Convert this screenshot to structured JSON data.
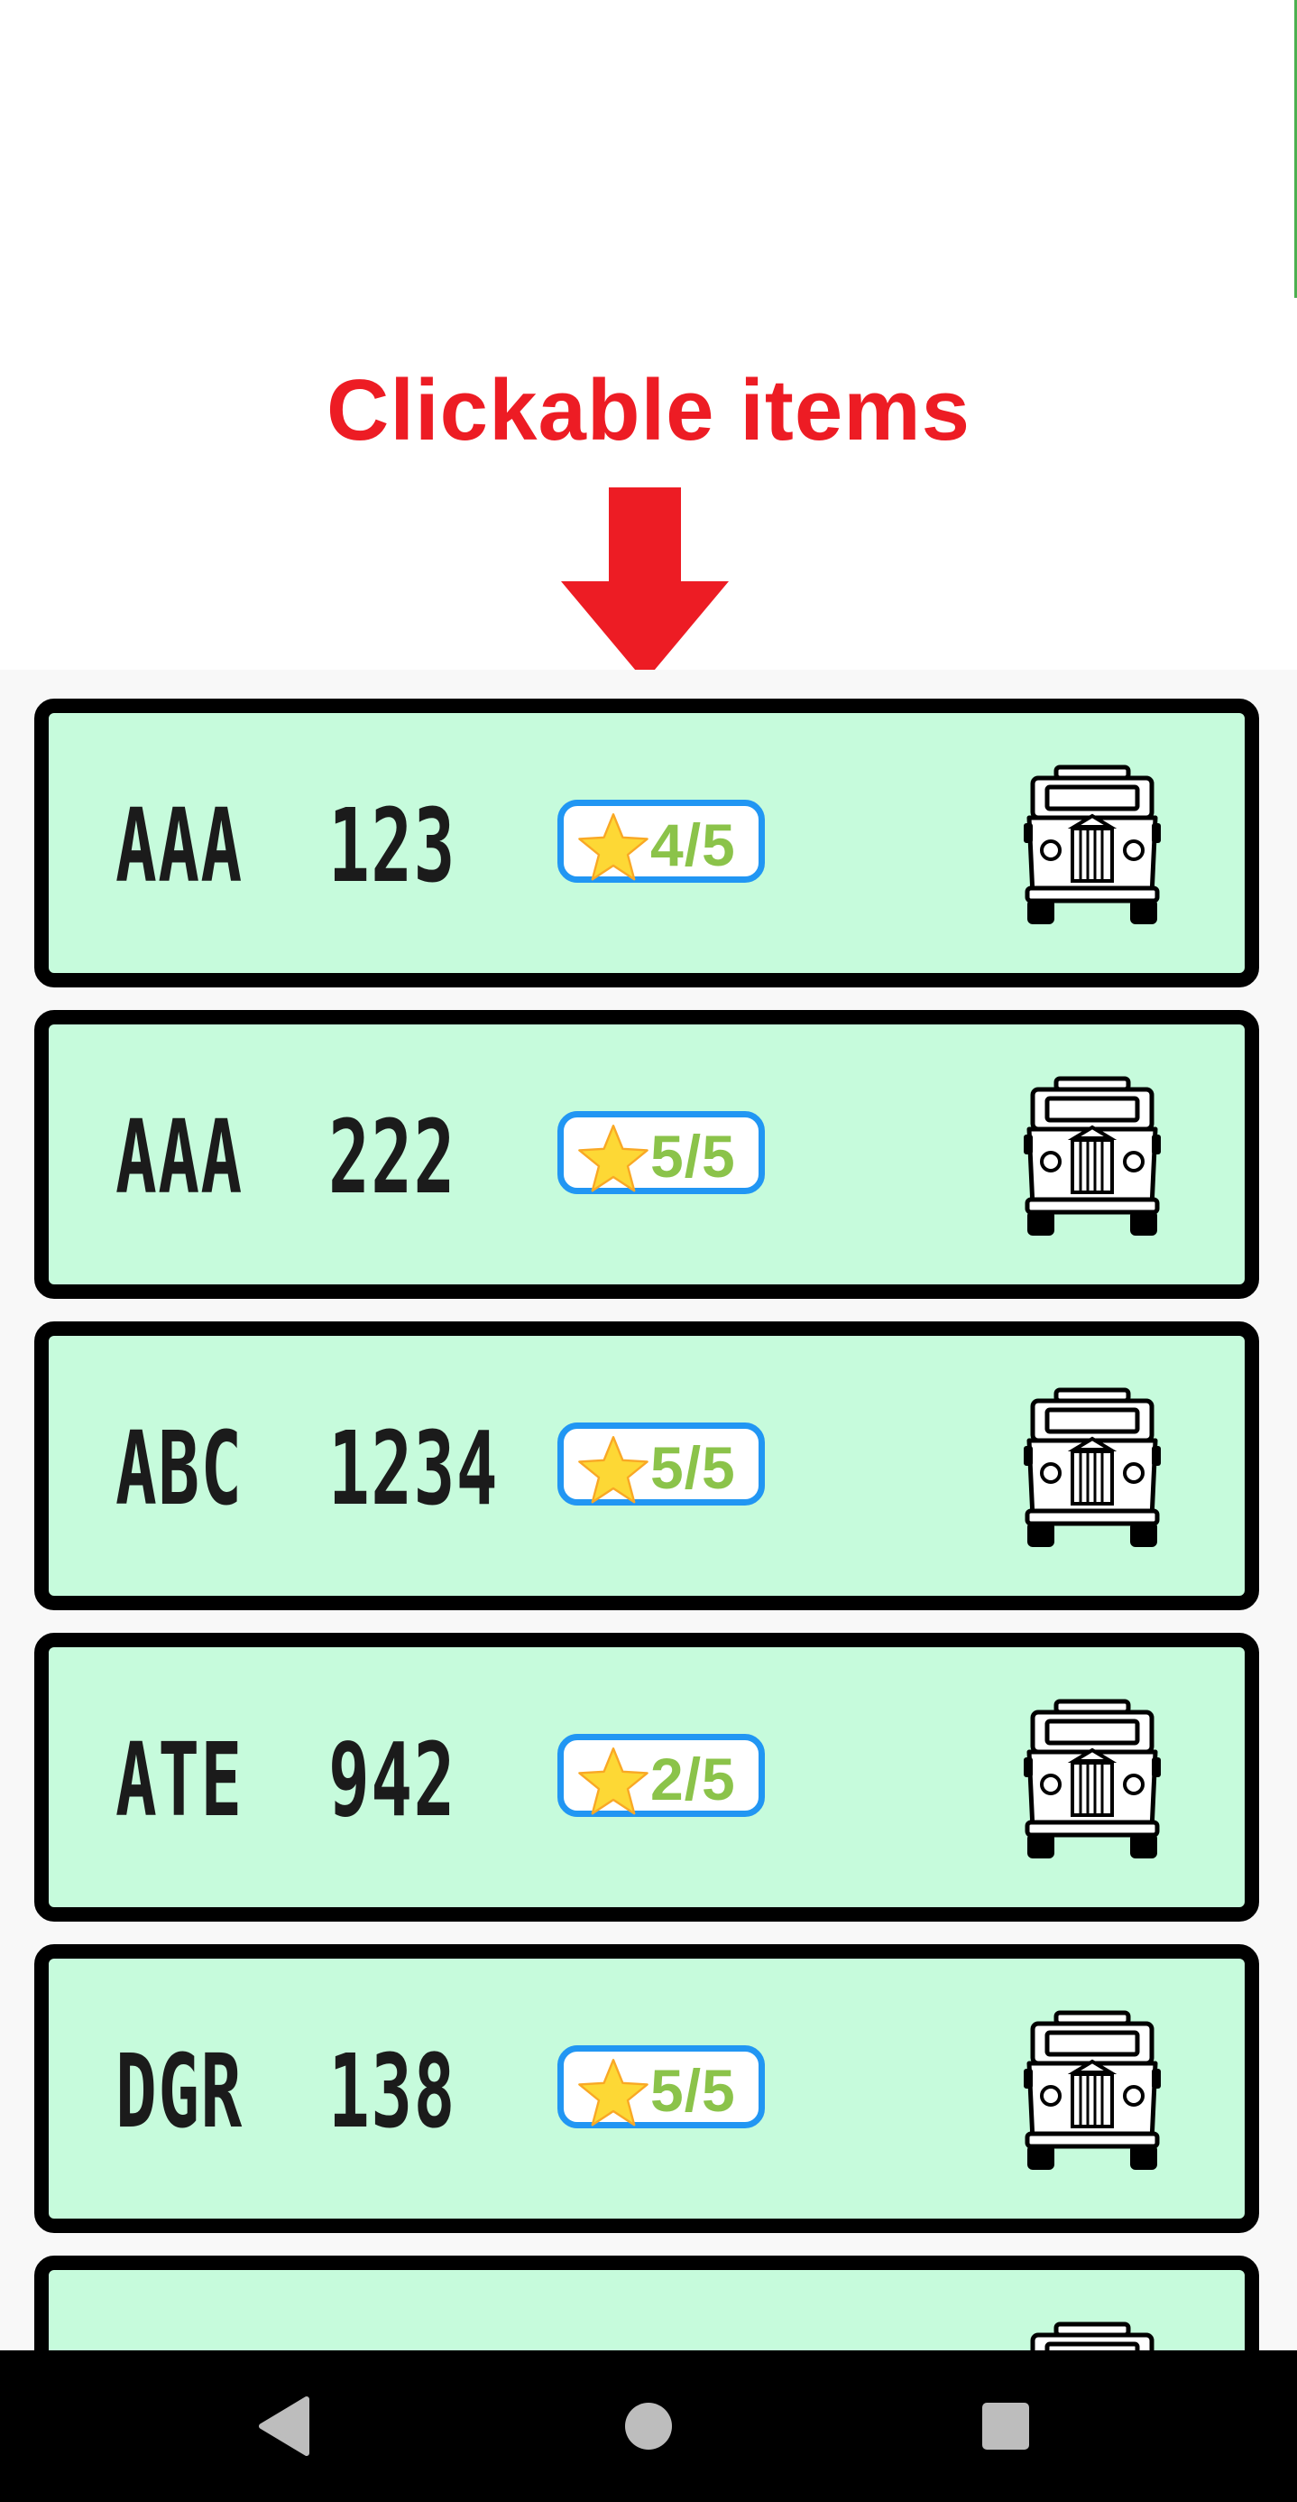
{
  "annotation": {
    "title": "Clickable items",
    "color": "#ed1c24",
    "arrow_icon": "down-arrow-icon"
  },
  "colors": {
    "card_background": "#c6fbdc",
    "card_border": "#000000",
    "rating_border": "#2196f3",
    "rating_text": "#8bc34a",
    "star": "#fdd835"
  },
  "vehicles": [
    {
      "plate": "AAA  123",
      "rating": "4/5",
      "icon": "jeepney-icon"
    },
    {
      "plate": "AAA  222",
      "rating": "5/5",
      "icon": "jeepney-icon"
    },
    {
      "plate": "ABC  1234",
      "rating": "5/5",
      "icon": "jeepney-icon"
    },
    {
      "plate": "ATE  942",
      "rating": "2/5",
      "icon": "jeepney-icon"
    },
    {
      "plate": "DGR  138",
      "rating": "5/5",
      "icon": "jeepney-icon"
    },
    {
      "plate": "",
      "rating": "",
      "icon": "jeepney-icon"
    }
  ],
  "nav_bar": {
    "back_icon": "back-triangle-icon",
    "home_icon": "home-circle-icon",
    "recents_icon": "recents-square-icon"
  }
}
